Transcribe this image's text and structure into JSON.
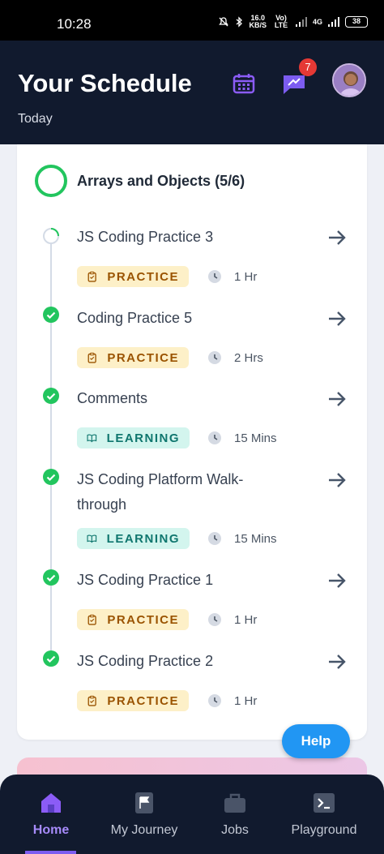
{
  "status_bar": {
    "time": "10:28",
    "speed": "16.0\nKB/S",
    "network": "Vo) LTE",
    "signal_label": "4G",
    "battery": "38"
  },
  "header": {
    "title": "Your Schedule",
    "subtitle": "Today",
    "notification_count": "7",
    "calendar_icon": "calendar-icon",
    "chat_icon": "chat-bubble-icon"
  },
  "schedule": {
    "group_title": "Arrays and Objects (5/6)",
    "items": [
      {
        "title": "JS Coding Practice 3",
        "tag": "PRACTICE",
        "duration": "1 Hr",
        "status": "in-progress"
      },
      {
        "title": "Coding Practice 5",
        "tag": "PRACTICE",
        "duration": "2 Hrs",
        "status": "completed"
      },
      {
        "title": "Comments",
        "tag": "LEARNING",
        "duration": "15 Mins",
        "status": "completed"
      },
      {
        "title": "JS Coding Platform Walk-through",
        "tag": "LEARNING",
        "duration": "15 Mins",
        "status": "completed"
      },
      {
        "title": "JS Coding Practice 1",
        "tag": "PRACTICE",
        "duration": "1 Hr",
        "status": "completed"
      },
      {
        "title": "JS Coding Practice 2",
        "tag": "PRACTICE",
        "duration": "1 Hr",
        "status": "completed"
      }
    ]
  },
  "help_label": "Help",
  "bottom_nav": {
    "items": [
      {
        "label": "Home",
        "icon": "home-icon",
        "active": true
      },
      {
        "label": "My Journey",
        "icon": "flag-icon",
        "active": false
      },
      {
        "label": "Jobs",
        "icon": "briefcase-icon",
        "active": false
      },
      {
        "label": "Playground",
        "icon": "terminal-icon",
        "active": false
      }
    ]
  },
  "colors": {
    "header_bg": "#111a2e",
    "accent": "#7c5cf0",
    "complete_green": "#22c55e",
    "help_blue": "#2196f3"
  }
}
